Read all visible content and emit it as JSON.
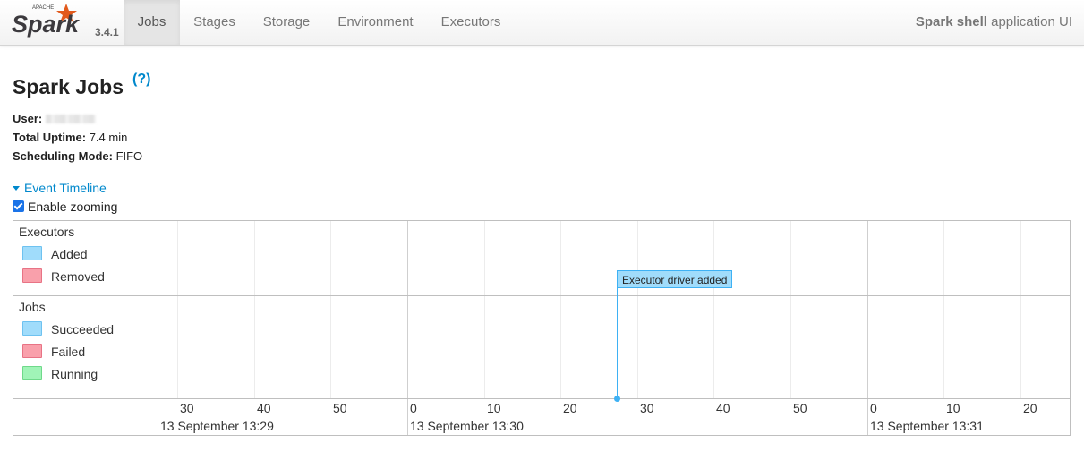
{
  "navbar": {
    "brand_small": "APACHE",
    "brand": "Spark",
    "version": "3.4.1",
    "tabs": [
      "Jobs",
      "Stages",
      "Storage",
      "Environment",
      "Executors"
    ],
    "active_tab": "Jobs",
    "app_title_bold": "Spark shell",
    "app_title_rest": " application UI"
  },
  "page": {
    "title": "Spark Jobs",
    "help": "(?)",
    "user_label": "User:",
    "uptime_label": "Total Uptime:",
    "uptime_value": " 7.4 min",
    "mode_label": "Scheduling Mode:",
    "mode_value": " FIFO",
    "event_timeline": "Event Timeline",
    "enable_zooming": "Enable zooming"
  },
  "timeline": {
    "executors_group": "Executors",
    "executors_legend": [
      {
        "label": "Added",
        "fill": "#a0dcfb",
        "border": "#6ec2f0"
      },
      {
        "label": "Removed",
        "fill": "#f9a0ab",
        "border": "#e87385"
      }
    ],
    "jobs_group": "Jobs",
    "jobs_legend": [
      {
        "label": "Succeeded",
        "fill": "#a0dcfb",
        "border": "#6ec2f0"
      },
      {
        "label": "Failed",
        "fill": "#f9a0ab",
        "border": "#e87385"
      },
      {
        "label": "Running",
        "fill": "#a0f4b7",
        "border": "#6fd98a"
      }
    ],
    "ticks": [
      "30",
      "40",
      "50",
      "0",
      "10",
      "20",
      "30",
      "40",
      "50",
      "0",
      "10",
      "20"
    ],
    "dates": [
      "13 September 13:29",
      "13 September 13:30",
      "13 September 13:31"
    ],
    "event_label": "Executor driver added",
    "event_color": "#a0dcfb"
  }
}
